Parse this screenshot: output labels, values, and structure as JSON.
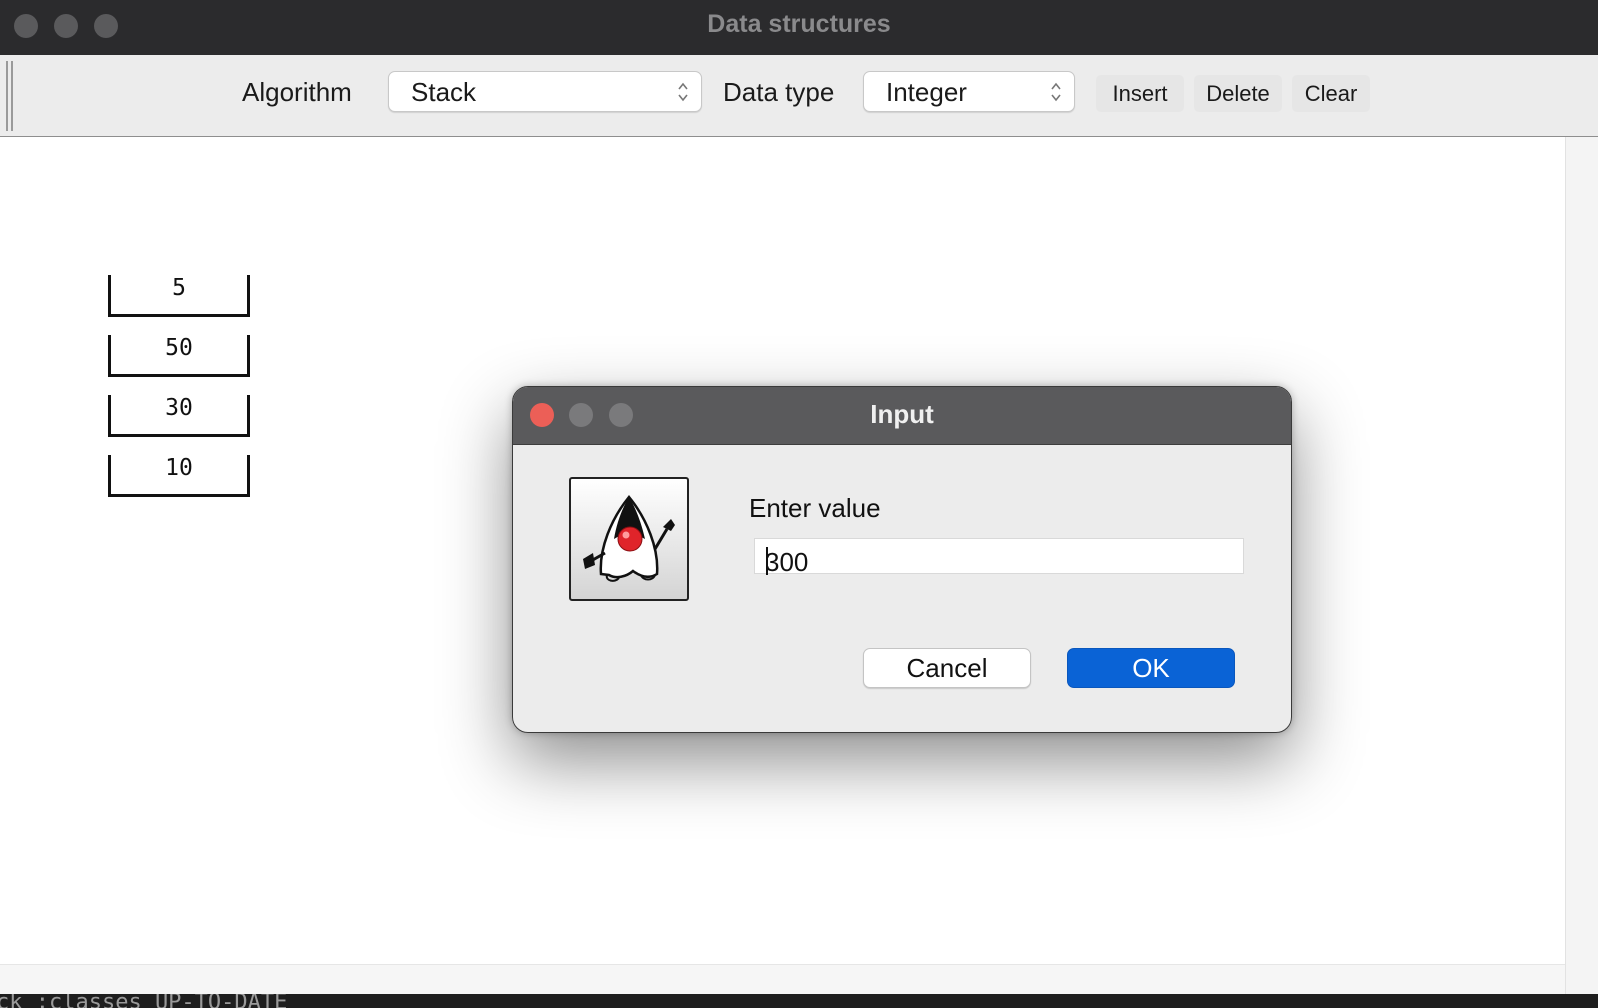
{
  "window": {
    "title": "Data structures"
  },
  "toolbar": {
    "algorithm_label": "Algorithm",
    "algorithm_value": "Stack",
    "datatype_label": "Data type",
    "datatype_value": "Integer",
    "insert_label": "Insert",
    "delete_label": "Delete",
    "clear_label": "Clear"
  },
  "stack": {
    "items": [
      "5",
      "50",
      "30",
      "10"
    ]
  },
  "dialog": {
    "title": "Input",
    "prompt": "Enter value",
    "input_value": "300",
    "cancel_label": "Cancel",
    "ok_label": "OK",
    "icon": "java-duke-icon"
  },
  "console": {
    "text": "ck :classes UP-TO-DATE"
  },
  "colors": {
    "ok_button": "#0a63d6",
    "close_button": "#ec5f57",
    "titlebar": "#2b2b2d"
  }
}
